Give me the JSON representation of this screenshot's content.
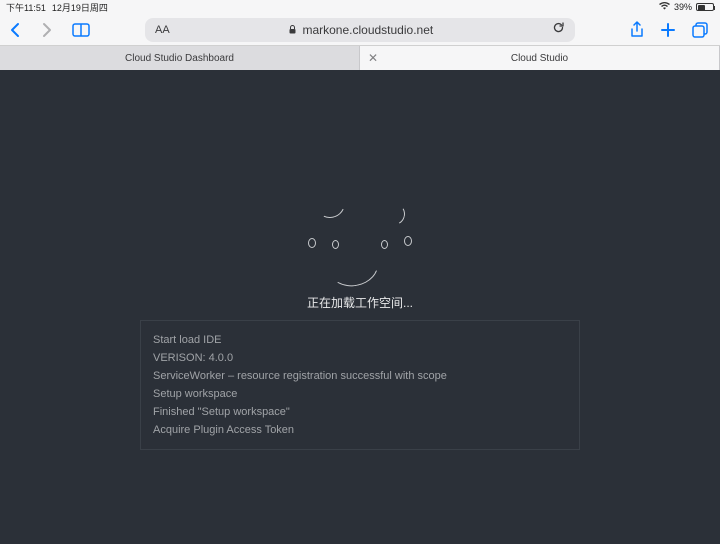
{
  "status": {
    "time": "下午11:51",
    "date": "12月19日周四",
    "battery_pct": "39%"
  },
  "toolbar": {
    "address_text": "markone.cloudstudio.net",
    "text_size": "AA"
  },
  "tabs": [
    {
      "label": "Cloud Studio Dashboard",
      "active": false
    },
    {
      "label": "Cloud Studio",
      "active": true
    }
  ],
  "loading": {
    "message": "正在加载工作空间..."
  },
  "log": [
    "Start load IDE",
    "VERISON: 4.0.0",
    "ServiceWorker – resource registration successful with scope",
    "Setup workspace",
    "Finished \"Setup workspace\"",
    "Acquire Plugin Access Token"
  ]
}
